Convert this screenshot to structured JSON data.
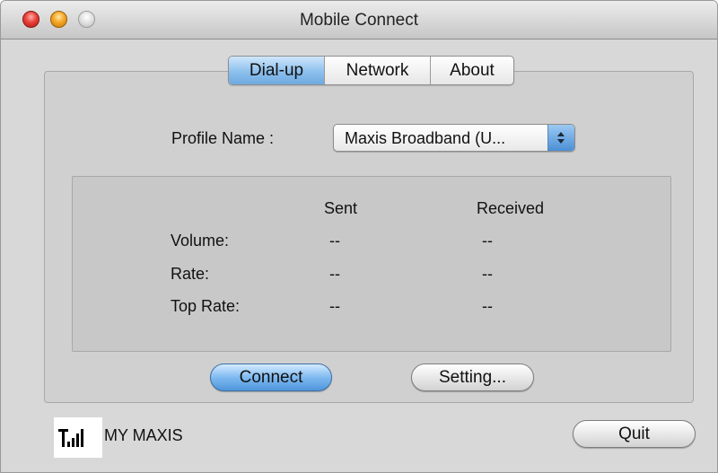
{
  "window": {
    "title": "Mobile Connect"
  },
  "tabs": [
    {
      "label": "Dial-up",
      "selected": true
    },
    {
      "label": "Network",
      "selected": false
    },
    {
      "label": "About",
      "selected": false
    }
  ],
  "profile": {
    "label": "Profile Name :",
    "selected_value": "Maxis Broadband (U..."
  },
  "stats": {
    "headers": {
      "sent": "Sent",
      "received": "Received"
    },
    "rows": [
      {
        "label": "Volume:",
        "sent": "--",
        "received": "--"
      },
      {
        "label": "Rate:",
        "sent": "--",
        "received": "--"
      },
      {
        "label": "Top Rate:",
        "sent": "--",
        "received": "--"
      }
    ]
  },
  "buttons": {
    "connect": "Connect",
    "setting": "Setting...",
    "quit": "Quit"
  },
  "status": {
    "carrier": "MY MAXIS",
    "signal_icon": "signal-strength-icon"
  },
  "colors": {
    "accent_blue": "#6ea9e0",
    "window_bg": "#d8d8d8"
  }
}
